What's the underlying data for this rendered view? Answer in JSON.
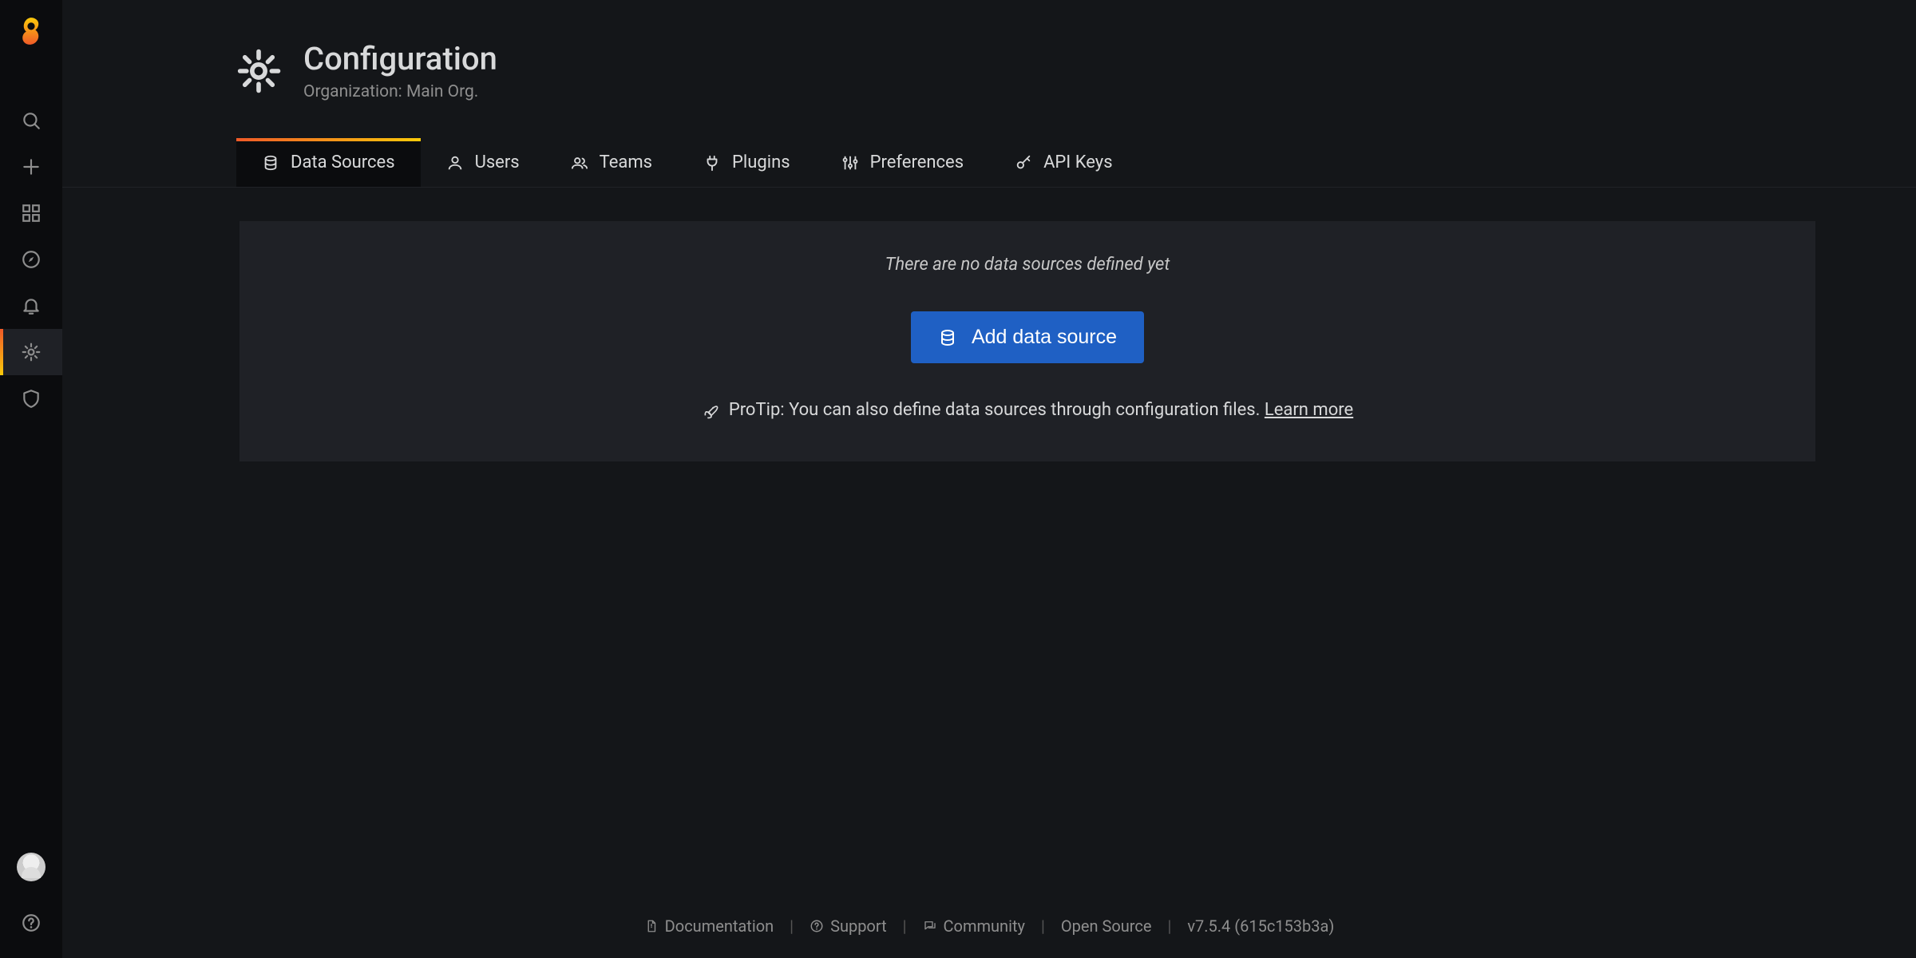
{
  "header": {
    "title": "Configuration",
    "subtitle": "Organization: Main Org."
  },
  "tabs": [
    {
      "label": "Data Sources",
      "icon": "database-icon",
      "active": true
    },
    {
      "label": "Users",
      "icon": "user-icon",
      "active": false
    },
    {
      "label": "Teams",
      "icon": "users-icon",
      "active": false
    },
    {
      "label": "Plugins",
      "icon": "plug-icon",
      "active": false
    },
    {
      "label": "Preferences",
      "icon": "sliders-icon",
      "active": false
    },
    {
      "label": "API Keys",
      "icon": "key-icon",
      "active": false
    }
  ],
  "panel": {
    "empty_msg": "There are no data sources defined yet",
    "add_button": "Add data source",
    "protip_prefix": "ProTip: You can also define data sources through configuration files. ",
    "protip_link": "Learn more"
  },
  "footer": {
    "documentation": "Documentation",
    "support": "Support",
    "community": "Community",
    "open_source": "Open Source",
    "version": "v7.5.4 (615c153b3a)"
  }
}
